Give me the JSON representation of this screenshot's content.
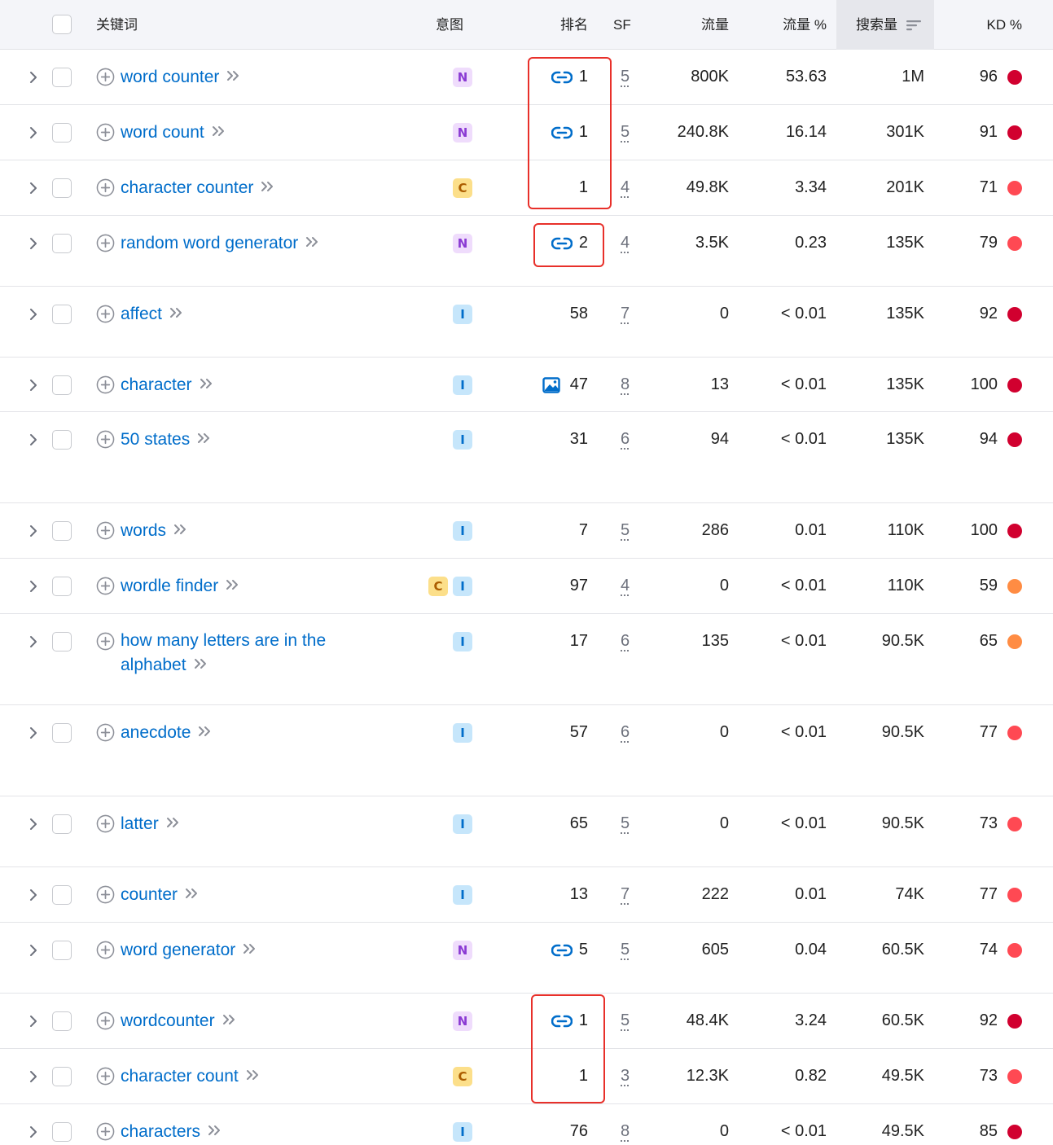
{
  "colors": {
    "keyword_link": "#006dca",
    "highlight_box": "#e8302a",
    "kd_very_hard": "#d1002f",
    "kd_hard": "#ff4953",
    "kd_difficult": "#ff8c43"
  },
  "header": {
    "keyword": "关键词",
    "intent": "意图",
    "rank": "排名",
    "sf": "SF",
    "traffic": "流量",
    "traffic_pct": "流量 %",
    "volume": "搜索量",
    "kd": "KD %"
  },
  "rows": [
    {
      "keyword": "word counter",
      "intents": [
        "N"
      ],
      "rank": "1",
      "rank_icon": "link-icon",
      "sf": "5",
      "traffic": "800K",
      "traffic_pct": "53.63",
      "volume": "1M",
      "kd": "96",
      "kd_level": "kd_very_hard"
    },
    {
      "keyword": "word count",
      "intents": [
        "N"
      ],
      "rank": "1",
      "rank_icon": "link-icon",
      "sf": "5",
      "traffic": "240.8K",
      "traffic_pct": "16.14",
      "volume": "301K",
      "kd": "91",
      "kd_level": "kd_very_hard"
    },
    {
      "keyword": "character counter",
      "intents": [
        "C"
      ],
      "rank": "1",
      "rank_icon": "",
      "sf": "4",
      "traffic": "49.8K",
      "traffic_pct": "3.34",
      "volume": "201K",
      "kd": "71",
      "kd_level": "kd_hard"
    },
    {
      "keyword": "random word generator",
      "intents": [
        "N"
      ],
      "rank": "2",
      "rank_icon": "link-icon",
      "sf": "4",
      "traffic": "3.5K",
      "traffic_pct": "0.23",
      "volume": "135K",
      "kd": "79",
      "kd_level": "kd_hard"
    },
    {
      "keyword": "affect",
      "intents": [
        "I"
      ],
      "rank": "58",
      "rank_icon": "",
      "sf": "7",
      "traffic": "0",
      "traffic_pct": "< 0.01",
      "volume": "135K",
      "kd": "92",
      "kd_level": "kd_very_hard"
    },
    {
      "keyword": "character",
      "intents": [
        "I"
      ],
      "rank": "47",
      "rank_icon": "image-icon",
      "sf": "8",
      "traffic": "13",
      "traffic_pct": "< 0.01",
      "volume": "135K",
      "kd": "100",
      "kd_level": "kd_very_hard"
    },
    {
      "keyword": "50 states",
      "intents": [
        "I"
      ],
      "rank": "31",
      "rank_icon": "",
      "sf": "6",
      "traffic": "94",
      "traffic_pct": "< 0.01",
      "volume": "135K",
      "kd": "94",
      "kd_level": "kd_very_hard"
    },
    {
      "keyword": "words",
      "intents": [
        "I"
      ],
      "rank": "7",
      "rank_icon": "",
      "sf": "5",
      "traffic": "286",
      "traffic_pct": "0.01",
      "volume": "110K",
      "kd": "100",
      "kd_level": "kd_very_hard"
    },
    {
      "keyword": "wordle finder",
      "intents": [
        "C",
        "I"
      ],
      "rank": "97",
      "rank_icon": "",
      "sf": "4",
      "traffic": "0",
      "traffic_pct": "< 0.01",
      "volume": "110K",
      "kd": "59",
      "kd_level": "kd_difficult"
    },
    {
      "keyword": "how many letters are in the alphabet",
      "intents": [
        "I"
      ],
      "rank": "17",
      "rank_icon": "",
      "sf": "6",
      "traffic": "135",
      "traffic_pct": "< 0.01",
      "volume": "90.5K",
      "kd": "65",
      "kd_level": "kd_difficult"
    },
    {
      "keyword": "anecdote",
      "intents": [
        "I"
      ],
      "rank": "57",
      "rank_icon": "",
      "sf": "6",
      "traffic": "0",
      "traffic_pct": "< 0.01",
      "volume": "90.5K",
      "kd": "77",
      "kd_level": "kd_hard"
    },
    {
      "keyword": "latter",
      "intents": [
        "I"
      ],
      "rank": "65",
      "rank_icon": "",
      "sf": "5",
      "traffic": "0",
      "traffic_pct": "< 0.01",
      "volume": "90.5K",
      "kd": "73",
      "kd_level": "kd_hard"
    },
    {
      "keyword": "counter",
      "intents": [
        "I"
      ],
      "rank": "13",
      "rank_icon": "",
      "sf": "7",
      "traffic": "222",
      "traffic_pct": "0.01",
      "volume": "74K",
      "kd": "77",
      "kd_level": "kd_hard"
    },
    {
      "keyword": "word generator",
      "intents": [
        "N"
      ],
      "rank": "5",
      "rank_icon": "link-icon",
      "sf": "5",
      "traffic": "605",
      "traffic_pct": "0.04",
      "volume": "60.5K",
      "kd": "74",
      "kd_level": "kd_hard"
    },
    {
      "keyword": "wordcounter",
      "intents": [
        "N"
      ],
      "rank": "1",
      "rank_icon": "link-icon",
      "sf": "5",
      "traffic": "48.4K",
      "traffic_pct": "3.24",
      "volume": "60.5K",
      "kd": "92",
      "kd_level": "kd_very_hard"
    },
    {
      "keyword": "character count",
      "intents": [
        "C"
      ],
      "rank": "1",
      "rank_icon": "",
      "sf": "3",
      "traffic": "12.3K",
      "traffic_pct": "0.82",
      "volume": "49.5K",
      "kd": "73",
      "kd_level": "kd_hard"
    },
    {
      "keyword": "characters",
      "intents": [
        "I"
      ],
      "rank": "76",
      "rank_icon": "",
      "sf": "8",
      "traffic": "0",
      "traffic_pct": "< 0.01",
      "volume": "49.5K",
      "kd": "85",
      "kd_level": "kd_very_hard"
    }
  ]
}
